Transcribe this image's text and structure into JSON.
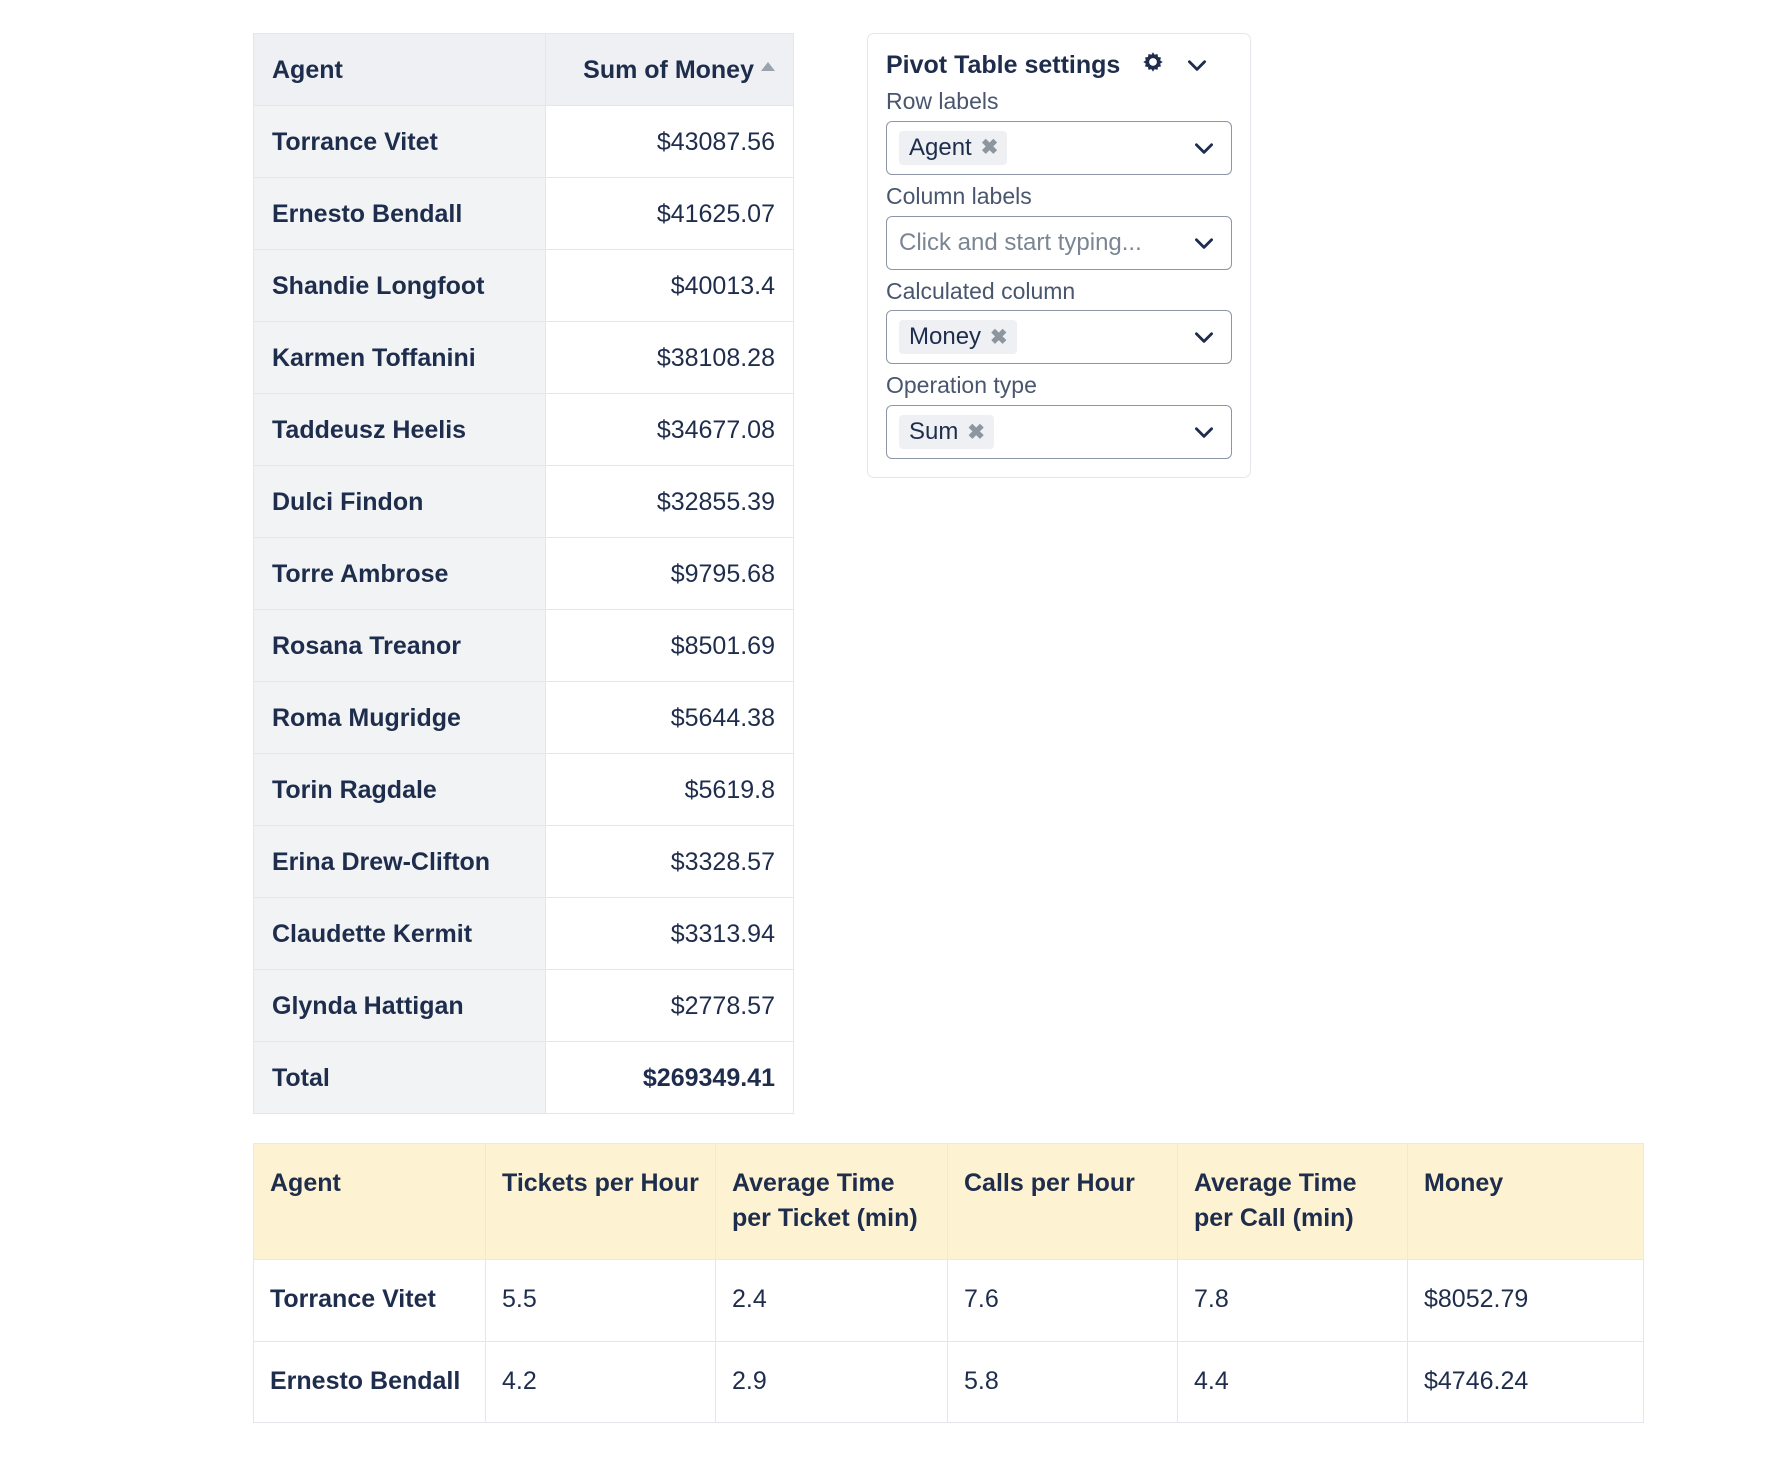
{
  "pivot_table": {
    "headers": {
      "agent": "Agent",
      "sum_of_money": "Sum of Money",
      "sort_direction": "ascending"
    },
    "rows": [
      {
        "agent": "Torrance Vitet",
        "sum": "$43087.56"
      },
      {
        "agent": "Ernesto Bendall",
        "sum": "$41625.07"
      },
      {
        "agent": "Shandie Longfoot",
        "sum": "$40013.4"
      },
      {
        "agent": "Karmen Toffanini",
        "sum": "$38108.28"
      },
      {
        "agent": "Taddeusz Heelis",
        "sum": "$34677.08"
      },
      {
        "agent": "Dulci Findon",
        "sum": "$32855.39"
      },
      {
        "agent": "Torre Ambrose",
        "sum": "$9795.68"
      },
      {
        "agent": "Rosana Treanor",
        "sum": "$8501.69"
      },
      {
        "agent": "Roma Mugridge",
        "sum": "$5644.38"
      },
      {
        "agent": "Torin Ragdale",
        "sum": "$5619.8"
      },
      {
        "agent": "Erina Drew-Clifton",
        "sum": "$3328.57"
      },
      {
        "agent": "Claudette Kermit",
        "sum": "$3313.94"
      },
      {
        "agent": "Glynda Hattigan",
        "sum": "$2778.57"
      }
    ],
    "total": {
      "label": "Total",
      "sum": "$269349.41"
    }
  },
  "settings_panel": {
    "title": "Pivot Table settings",
    "gear_icon": "gear-icon",
    "collapse_icon": "chevron-down-icon",
    "fields": [
      {
        "label": "Row labels",
        "chip": "Agent",
        "placeholder": ""
      },
      {
        "label": "Column labels",
        "chip": "",
        "placeholder": "Click and start typing..."
      },
      {
        "label": "Calculated column",
        "chip": "Money",
        "placeholder": ""
      },
      {
        "label": "Operation type",
        "chip": "Sum",
        "placeholder": ""
      }
    ],
    "chip_remove_glyph": "✖"
  },
  "data_table": {
    "columns": [
      "Agent",
      "Tickets per Hour",
      "Average Time per Ticket (min)",
      "Calls per Hour",
      "Average Time per Call (min)",
      "Money"
    ],
    "rows": [
      [
        "Torrance Vitet",
        "5.5",
        "2.4",
        "7.6",
        "7.8",
        "$8052.79"
      ],
      [
        "Ernesto Bendall",
        "4.2",
        "2.9",
        "5.8",
        "4.4",
        "$4746.24"
      ]
    ]
  },
  "colors": {
    "text": "#1f2d4d",
    "pivot_header_bg": "#eef0f3",
    "pivot_rowlabel_bg": "#f1f3f5",
    "data_header_bg": "#fdf3d2",
    "border": "#e3e6ea",
    "chip_bg": "#eef0f3",
    "placeholder": "#7b8593"
  }
}
